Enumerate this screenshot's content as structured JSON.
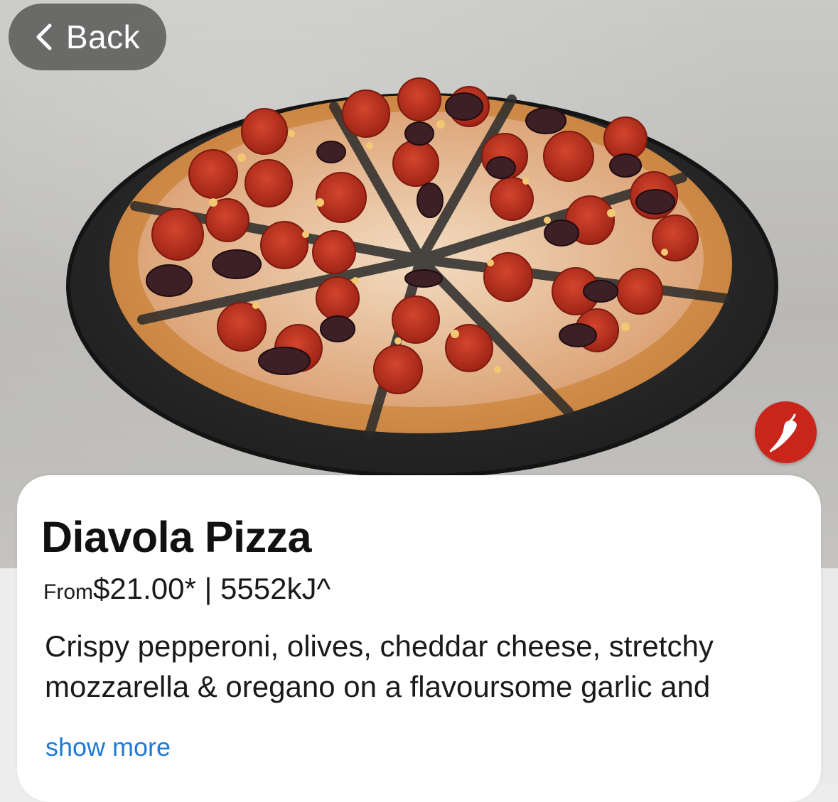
{
  "navigation": {
    "back_label": "Back"
  },
  "product": {
    "name": "Diavola Pizza",
    "from_label": "From",
    "price_line": "$21.00* | 5552kJ^",
    "description": "Crispy pepperoni, olives, cheddar cheese, stretchy mozzarella & oregano on a flavoursome garlic and",
    "show_more_label": "show more",
    "spicy_icon": "chilli-pepper-icon"
  },
  "colors": {
    "spicy_badge": "#c9251b",
    "link": "#1f7ad6",
    "back_button_bg": "#545452"
  }
}
